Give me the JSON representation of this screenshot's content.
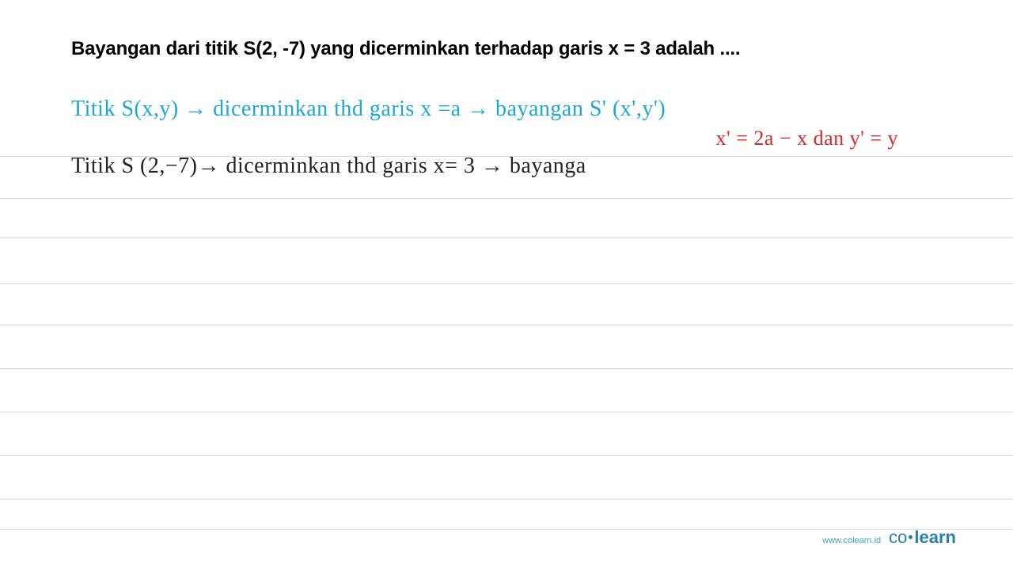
{
  "question": "Bayangan dari titik S(2, -7) yang dicerminkan terhadap garis x  =  3 adalah ....",
  "lines": {
    "blue": "Titik S(x,y) → dicerminkan thd garis x =a → bayangan S' (x',y')",
    "red": "x' = 2a − x  dan  y' = y",
    "black": "Titik S (2,−7)→ dicerminkan thd garis  x= 3 → bayanga"
  },
  "footer": {
    "url": "www.colearn.id",
    "brand_part1": "co",
    "brand_part2": "learn"
  },
  "rule_positions": [
    197,
    250,
    300,
    358,
    410,
    465,
    520,
    575,
    630,
    668
  ]
}
